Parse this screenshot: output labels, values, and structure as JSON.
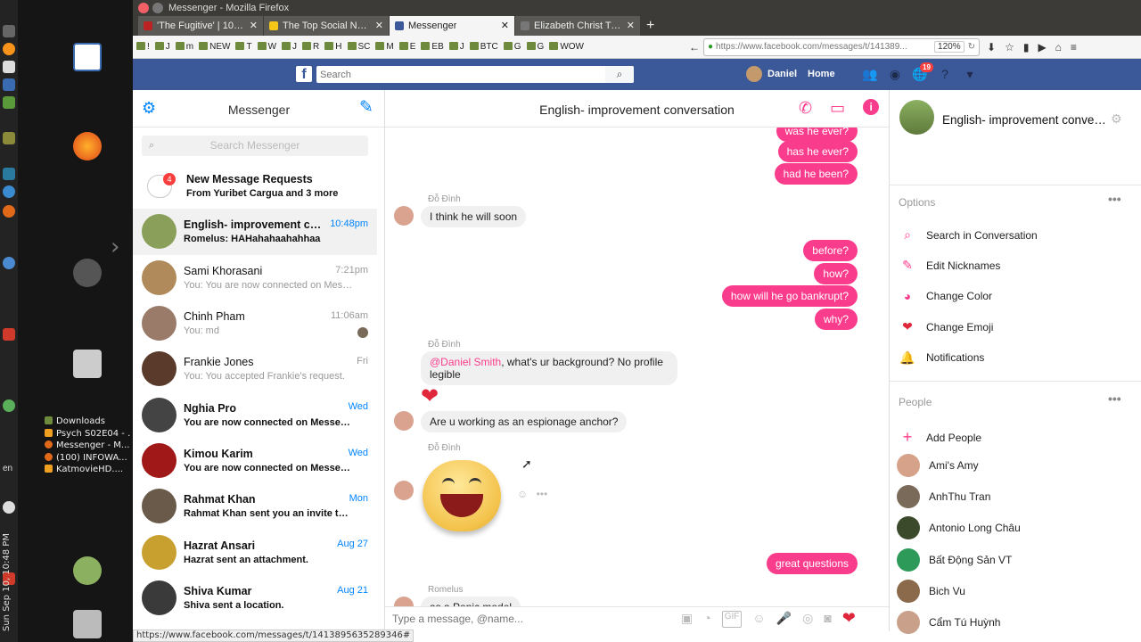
{
  "window": {
    "title": "Messenger - Mozilla Firefox"
  },
  "desktop": {
    "clock": "Sun Sep 10, 10:48 PM",
    "lang": "en",
    "downloads": [
      "Downloads",
      "Psych S02E04 - ...",
      "Messenger - M...",
      "(100) INFOWA...",
      "KatmovieHD...."
    ]
  },
  "tabs": [
    {
      "label": "'The Fugitive' | 100 Gre",
      "color": "#b22"
    },
    {
      "label": "The Top Social Network",
      "color": "#f5c518"
    },
    {
      "label": "Messenger",
      "color": "#3b5998",
      "active": true
    },
    {
      "label": "Elizabeth Christ Trump",
      "color": "#777"
    }
  ],
  "newtab": "+",
  "bookmarks": [
    "!",
    "J",
    "m",
    "NEW",
    "T",
    "W",
    "J",
    "R",
    "H",
    "SC",
    "M",
    "E",
    "EB",
    "J",
    "BTC",
    "G",
    "G",
    "WOW"
  ],
  "url": {
    "value": "https://www.facebook.com/messages/t/141389...",
    "zoom": "120%"
  },
  "fb": {
    "search_placeholder": "Search",
    "user": "Daniel",
    "home": "Home",
    "notif_count": "19"
  },
  "left": {
    "title": "Messenger",
    "search_placeholder": "Search Messenger",
    "request": {
      "count": "4",
      "name": "New Message Requests",
      "snippet": "From Yuribet Cargua and 3 more"
    },
    "conversations": [
      {
        "name": "English- improvement con...",
        "snippet": "Romelus: HAHahahaahahhaa",
        "time": "10:48pm",
        "bold": true,
        "active": true,
        "color": "#8aa05a"
      },
      {
        "name": "Sami Khorasani",
        "snippet": "You: You are now connected on Mess...",
        "time": "7:21pm",
        "bold": false,
        "color": "#b08a5a"
      },
      {
        "name": "Chinh Pham",
        "snippet": "You: md",
        "time": "11:06am",
        "bold": false,
        "color": "#9a7b6a"
      },
      {
        "name": "Frankie Jones",
        "snippet": "You: You accepted Frankie's request.",
        "time": "Fri",
        "bold": false,
        "color": "#5a3a2a"
      },
      {
        "name": "Nghia Pro",
        "snippet": "You are now connected on Messen...",
        "time": "Wed",
        "bold": true,
        "color": "#444"
      },
      {
        "name": "Kimou Karim",
        "snippet": "You are now connected on Messen...",
        "time": "Wed",
        "bold": true,
        "color": "#a01818"
      },
      {
        "name": "Rahmat Khan",
        "snippet": "Rahmat Khan sent you an invite to j...",
        "time": "Mon",
        "bold": true,
        "color": "#6a5a4a"
      },
      {
        "name": "Hazrat Ansari",
        "snippet": "Hazrat sent an attachment.",
        "time": "Aug 27",
        "bold": true,
        "color": "#c8a030"
      },
      {
        "name": "Shiva Kumar",
        "snippet": "Shiva sent a location.",
        "time": "Aug 21",
        "bold": true,
        "color": "#3a3a3a"
      }
    ]
  },
  "chat": {
    "title": "English- improvement conversation",
    "composer_placeholder": "Type a message, @name...",
    "messages_right_top": [
      "was he ever?",
      "has he ever?",
      "had he been?"
    ],
    "sender1": "Đỗ Đình",
    "msg1": "I think he will soon",
    "messages_right_mid": [
      "before?",
      "how?",
      "how will he go bankrupt?",
      "why?"
    ],
    "sender2": "Đỗ Đình",
    "mention": "@Daniel Smith",
    "msg2_rest": ", what's ur background? No profile legible",
    "msg3": "Are u working as an espionage anchor?",
    "sender3": "Đỗ Đình",
    "msg_right_bottom": "great questions",
    "sender4": "Romelus",
    "msg4": "as a Ponic model"
  },
  "right": {
    "title": "English- improvement conver...",
    "options_label": "Options",
    "options": [
      {
        "label": "Search in Conversation",
        "icon": "search-icon"
      },
      {
        "label": "Edit Nicknames",
        "icon": "pencil-icon"
      },
      {
        "label": "Change Color",
        "icon": "palette-icon"
      },
      {
        "label": "Change Emoji",
        "icon": "heart-icon"
      },
      {
        "label": "Notifications",
        "icon": "bell-icon"
      }
    ],
    "people_label": "People",
    "add_people": "Add People",
    "people": [
      {
        "name": "Ami's Amy",
        "color": "#d7a28a"
      },
      {
        "name": "AnhThu Tran",
        "color": "#7a6a5a"
      },
      {
        "name": "Antonio Long Châu",
        "color": "#3a4a2a"
      },
      {
        "name": "Bất Động Sản VT",
        "color": "#2e9a5a"
      },
      {
        "name": "Bich Vu",
        "color": "#8a6a4a"
      },
      {
        "name": "Cẩm Tú Huỳnh",
        "color": "#c9a08a"
      }
    ]
  },
  "status_url": "https://www.facebook.com/messages/t/1413895635289346#"
}
